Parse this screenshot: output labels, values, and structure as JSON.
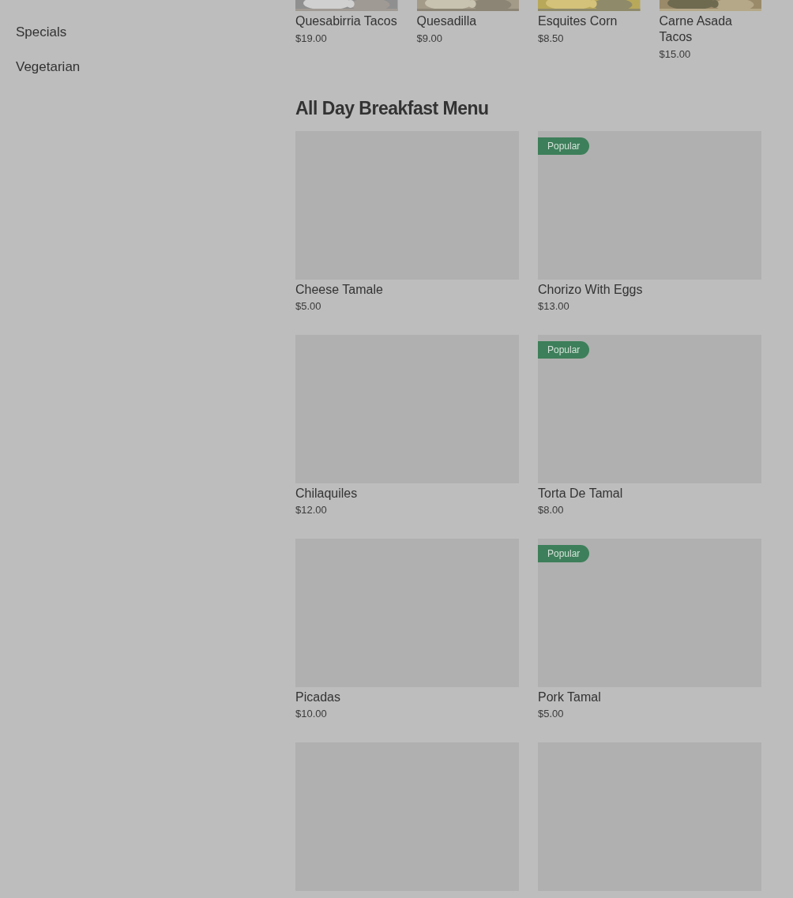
{
  "sidebar": {
    "items": [
      {
        "label": "Specials"
      },
      {
        "label": "Vegetarian"
      }
    ]
  },
  "top_items": [
    {
      "name": "Quesabirria Tacos",
      "price": "$19.00",
      "kind": "picture"
    },
    {
      "name": "Quesadilla",
      "price": "$9.00",
      "kind": "picture"
    },
    {
      "name": "Esquites Corn",
      "price": "$8.50",
      "kind": "picture"
    },
    {
      "name": "Carne Asada Tacos",
      "price": "$15.00",
      "kind": "picture"
    }
  ],
  "section": {
    "title": "All Day Breakfast Menu",
    "items": [
      {
        "name": "Cheese Tamale",
        "price": "$5.00",
        "popular": false
      },
      {
        "name": "Chorizo With Eggs",
        "price": "$13.00",
        "popular": true,
        "badge": "Popular"
      },
      {
        "name": "Chilaquiles",
        "price": "$12.00",
        "popular": false
      },
      {
        "name": "Torta De Tamal",
        "price": "$8.00",
        "popular": true,
        "badge": "Popular"
      },
      {
        "name": "Picadas",
        "price": "$10.00",
        "popular": false
      },
      {
        "name": "Pork Tamal",
        "price": "$5.00",
        "popular": true,
        "badge": "Popular"
      },
      {
        "popular": false
      },
      {
        "popular": false
      }
    ]
  }
}
